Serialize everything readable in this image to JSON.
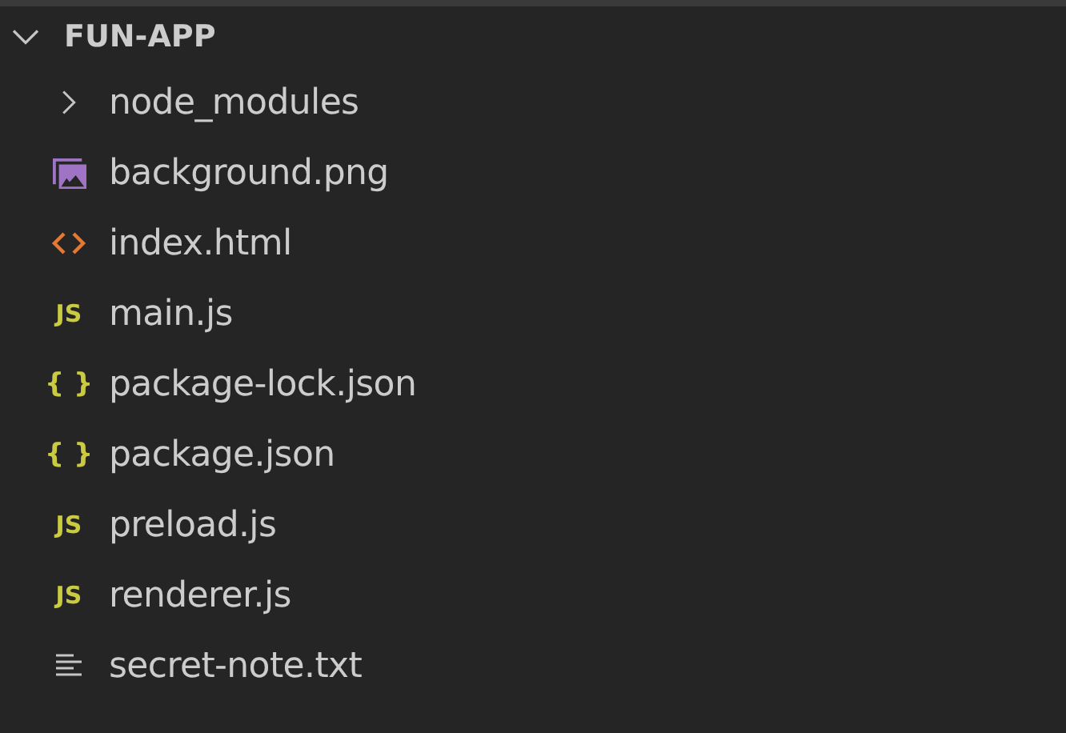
{
  "explorer": {
    "root": {
      "label": "FUN-APP",
      "expanded": true,
      "children": [
        {
          "kind": "folder",
          "label": "node_modules",
          "expanded": false
        },
        {
          "kind": "image",
          "label": "background.png"
        },
        {
          "kind": "html",
          "label": "index.html"
        },
        {
          "kind": "js",
          "icon": "JS",
          "label": "main.js"
        },
        {
          "kind": "json",
          "icon": "{ }",
          "label": "package-lock.json"
        },
        {
          "kind": "json",
          "icon": "{ }",
          "label": "package.json"
        },
        {
          "kind": "js",
          "icon": "JS",
          "label": "preload.js"
        },
        {
          "kind": "js",
          "icon": "JS",
          "label": "renderer.js"
        },
        {
          "kind": "text",
          "label": "secret-note.txt"
        }
      ]
    }
  }
}
